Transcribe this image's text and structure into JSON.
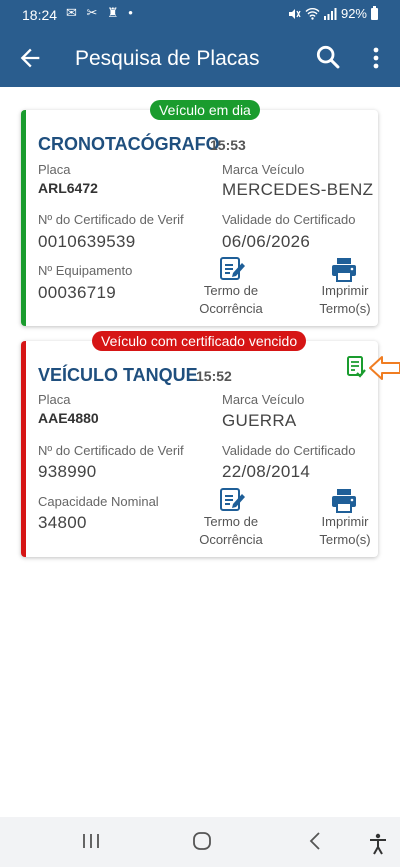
{
  "status": {
    "time": "18:24",
    "notification_glyphs": "✉ ✂ ♜ •",
    "battery": "92%"
  },
  "appbar": {
    "title": "Pesquisa de Placas",
    "back_icon": "arrow-left-icon",
    "search_icon": "search-icon",
    "more_icon": "more-vert-icon"
  },
  "cards": [
    {
      "badge": "Veículo em dia",
      "badge_color": "#1a9c2e",
      "type": "CRONOTACÓGRAFO",
      "time": "15:53",
      "placa_label": "Placa",
      "placa": "ARL6472",
      "marca_label": "Marca Veículo",
      "marca": "MERCEDES-BENZ",
      "cert_label": "Nº do Certificado de Verif",
      "cert": "0010639539",
      "validade_label": "Validade do Certificado",
      "validade": "06/06/2026",
      "extra_label": "Nº Equipamento",
      "extra": "00036719",
      "termo_line1": "Termo de",
      "termo_line2": "Ocorrência",
      "imprimir_line1": "Imprimir",
      "imprimir_line2": "Termo(s)"
    },
    {
      "badge": "Veículo com certificado vencido",
      "badge_color": "#d61515",
      "type": "VEÍCULO TANQUE",
      "time": "15:52",
      "placa_label": "Placa",
      "placa": "AAE4880",
      "marca_label": "Marca Veículo",
      "marca": "GUERRA",
      "cert_label": "Nº do Certificado de Verif",
      "cert": "938990",
      "validade_label": "Validade do Certificado",
      "validade": "22/08/2014",
      "extra_label": "Capacidade Nominal",
      "extra": "34800",
      "termo_line1": "Termo de",
      "termo_line2": "Ocorrência",
      "imprimir_line1": "Imprimir",
      "imprimir_line2": "Termo(s)"
    }
  ],
  "colors": {
    "primary": "#2a5d8e",
    "title_blue": "#1f4f7e",
    "ok_green": "#1a9c2e",
    "expired_red": "#d61515",
    "highlight_orange": "#f07d22"
  }
}
